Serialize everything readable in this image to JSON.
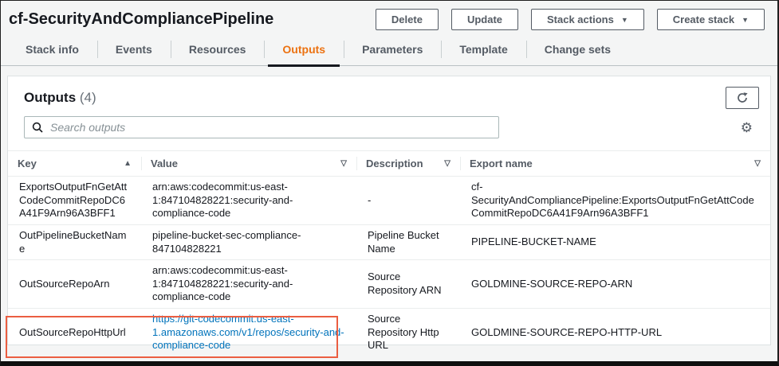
{
  "header": {
    "title": "cf-SecurityAndCompliancePipeline",
    "buttons": [
      {
        "label": "Delete"
      },
      {
        "label": "Update"
      },
      {
        "label": "Stack actions"
      },
      {
        "label": "Create stack"
      }
    ]
  },
  "tabs": {
    "items": [
      {
        "label": "Stack info"
      },
      {
        "label": "Events"
      },
      {
        "label": "Resources"
      },
      {
        "label": "Outputs"
      },
      {
        "label": "Parameters"
      },
      {
        "label": "Template"
      },
      {
        "label": "Change sets"
      }
    ],
    "active_tab": "Outputs"
  },
  "panel": {
    "title": "Outputs",
    "count": "(4)",
    "search": {
      "placeholder": "Search outputs"
    }
  },
  "table": {
    "columns": [
      {
        "label": "Key",
        "sort_icon": "▲"
      },
      {
        "label": "Value",
        "sort_icon": "▽"
      },
      {
        "label": "Description",
        "sort_icon": "▽"
      },
      {
        "label": "Export name",
        "sort_icon": "▽"
      }
    ],
    "rows": [
      {
        "key": "ExportsOutputFnGetAttCodeCommitRepoDC6A41F9Arn96A3BFF1",
        "value": "arn:aws:codecommit:us-east-1:847104828221:security-and-compliance-code",
        "description": "-",
        "export_name": "cf-SecurityAndCompliancePipeline:ExportsOutputFnGetAttCodeCommitRepoDC6A41F9Arn96A3BFF1"
      },
      {
        "key": "OutPipelineBucketName",
        "value": "pipeline-bucket-sec-compliance-847104828221",
        "description": "Pipeline Bucket Name",
        "export_name": "PIPELINE-BUCKET-NAME"
      },
      {
        "key": "OutSourceRepoArn",
        "value": "arn:aws:codecommit:us-east-1:847104828221:security-and-compliance-code",
        "description": "Source Repository ARN",
        "export_name": "GOLDMINE-SOURCE-REPO-ARN"
      },
      {
        "key": "OutSourceRepoHttpUrl",
        "value": "https://git-codecommit.us-east-1.amazonaws.com/v1/repos/security-and-compliance-code",
        "description": "Source Repository Http URL",
        "export_name": "GOLDMINE-SOURCE-REPO-HTTP-URL"
      }
    ]
  },
  "icons": {
    "caret_down": "▼",
    "gear": "⚙"
  },
  "colors": {
    "accent_orange": "#ec7211",
    "link_blue": "#0073bb",
    "highlight_red": "#eb5e41",
    "active_underline": "#16191f"
  }
}
